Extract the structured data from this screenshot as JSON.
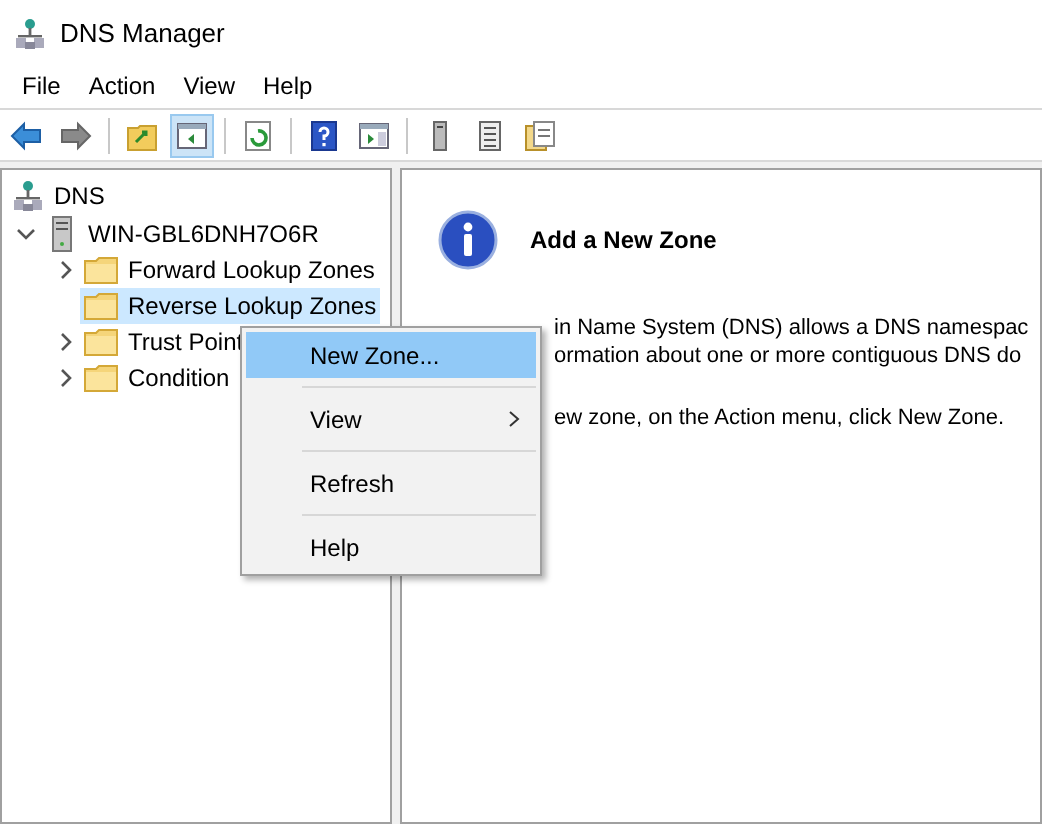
{
  "window": {
    "title": "DNS Manager"
  },
  "menu_bar": [
    "File",
    "Action",
    "View",
    "Help"
  ],
  "toolbar": [
    {
      "pressed": false
    },
    {
      "pressed": false
    },
    {
      "pressed": false
    },
    {
      "pressed": true
    },
    {
      "pressed": false
    },
    {
      "pressed": false
    },
    {
      "pressed": false
    },
    {
      "pressed": false
    },
    {
      "pressed": false
    },
    {
      "pressed": false
    }
  ],
  "tree": {
    "label": "DNS",
    "children": [
      {
        "label": "WIN-GBL6DNH7O6R",
        "expanded": true,
        "children": [
          {
            "label": "Forward Lookup Zones",
            "expandable": true,
            "selected": false
          },
          {
            "label": "Reverse Lookup Zones",
            "expandable": false,
            "selected": true
          },
          {
            "label": "Trust Point",
            "expandable": true,
            "selected": false
          },
          {
            "label": "Condition",
            "expandable": true,
            "selected": false
          }
        ]
      }
    ]
  },
  "detail": {
    "title": "Add a New Zone",
    "lines": [
      "in Name System (DNS) allows a DNS namespac",
      "ormation about one or more contiguous DNS do",
      "ew zone, on the Action menu, click New Zone."
    ]
  },
  "context_menu": [
    {
      "label": "New Zone...",
      "selected": true,
      "submenu": false
    },
    {
      "label": "View",
      "selected": false,
      "submenu": true
    },
    {
      "label": "Refresh",
      "selected": false,
      "submenu": false
    },
    {
      "label": "Help",
      "selected": false,
      "submenu": false
    }
  ]
}
